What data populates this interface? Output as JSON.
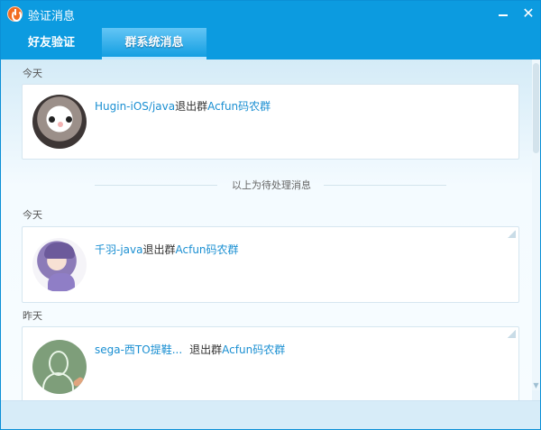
{
  "window": {
    "title": "验证消息",
    "min_icon": "minimize-icon",
    "close_icon": "close-icon",
    "close_glyph": "✕"
  },
  "tabs": [
    {
      "label": "好友验证"
    },
    {
      "label": "群系统消息"
    }
  ],
  "section_today_1": "今天",
  "divider": "以上为待处理消息",
  "section_today_2": "今天",
  "section_yesterday": "昨天",
  "messages": [
    {
      "user": "Hugin-iOS/java",
      "action": "退出群",
      "group": "Acfun码农群",
      "avatar": "cat-avatar"
    },
    {
      "user": "千羽-java",
      "action": "退出群",
      "group": "Acfun码农群",
      "avatar": "anime-avatar"
    },
    {
      "user": "sega-西TO提鞋...",
      "action": "退出群",
      "group": "Acfun码农群",
      "avatar": "chalk-avatar"
    }
  ],
  "colors": {
    "accent": "#0c9be0",
    "link": "#1a8fd2"
  }
}
